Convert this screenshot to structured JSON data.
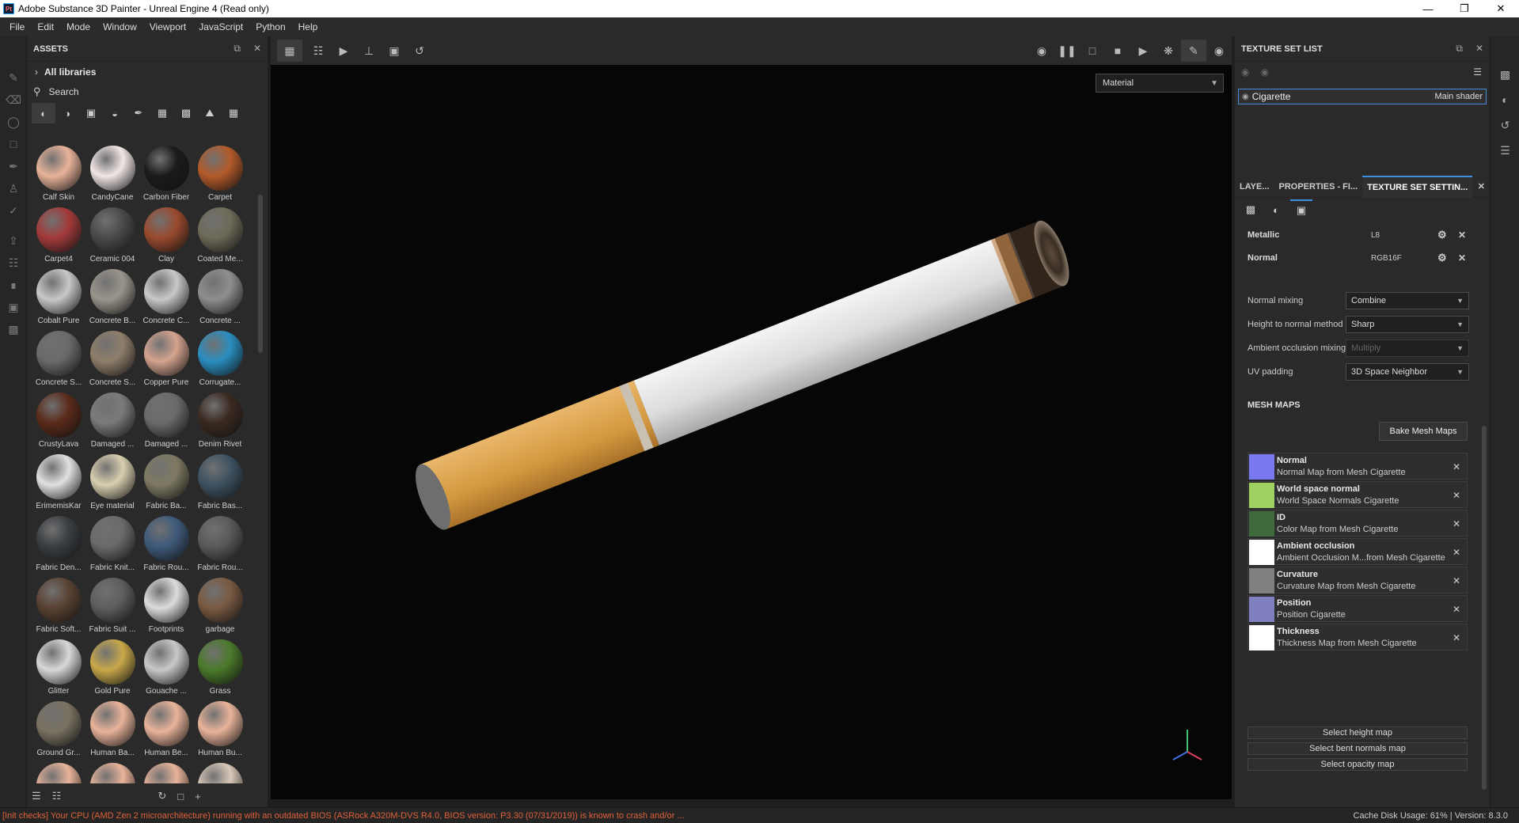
{
  "window": {
    "title": "Adobe Substance 3D Painter - Unreal Engine 4 (Read only)",
    "app_icon_text": "Pt"
  },
  "menu": [
    "File",
    "Edit",
    "Mode",
    "Window",
    "Viewport",
    "JavaScript",
    "Python",
    "Help"
  ],
  "assets": {
    "title": "ASSETS",
    "all_libraries": "All libraries",
    "search_label": "Search",
    "items": [
      {
        "name": "Calf Skin",
        "color": "#e8b39a"
      },
      {
        "name": "CandyCane",
        "color": "#f2e6e6"
      },
      {
        "name": "Carbon Fiber",
        "color": "#1b1b1b"
      },
      {
        "name": "Carpet",
        "color": "#b35a2a"
      },
      {
        "name": "Carpet4",
        "color": "#a33a3a"
      },
      {
        "name": "Ceramic 004",
        "color": "#4a4a4a"
      },
      {
        "name": "Clay",
        "color": "#9a4a2e"
      },
      {
        "name": "Coated Me...",
        "color": "#6e6a58"
      },
      {
        "name": "Cobalt Pure",
        "color": "#c8c8c8"
      },
      {
        "name": "Concrete B...",
        "color": "#9a958c"
      },
      {
        "name": "Concrete C...",
        "color": "#c8c8c8"
      },
      {
        "name": "Concrete ...",
        "color": "#8e8e8e"
      },
      {
        "name": "Concrete S...",
        "color": "#6a6a6a"
      },
      {
        "name": "Concrete S...",
        "color": "#8e7e6a"
      },
      {
        "name": "Copper Pure",
        "color": "#d4a38e"
      },
      {
        "name": "Corrugate...",
        "color": "#2a8ec0"
      },
      {
        "name": "CrustyLava",
        "color": "#5a2a1a"
      },
      {
        "name": "Damaged ...",
        "color": "#7a7a7a"
      },
      {
        "name": "Damaged ...",
        "color": "#6a6a6a"
      },
      {
        "name": "Denim Rivet",
        "color": "#3a2a20"
      },
      {
        "name": "ErimemisKar",
        "color": "#e0e0e0"
      },
      {
        "name": "Eye material",
        "color": "#d8cfb0"
      },
      {
        "name": "Fabric Ba...",
        "color": "#7e7a62"
      },
      {
        "name": "Fabric Bas...",
        "color": "#3e5262"
      },
      {
        "name": "Fabric Den...",
        "color": "#3a3e42"
      },
      {
        "name": "Fabric Knit...",
        "color": "#6a6a6a"
      },
      {
        "name": "Fabric Rou...",
        "color": "#3e5a7a"
      },
      {
        "name": "Fabric Rou...",
        "color": "#5a5a5a"
      },
      {
        "name": "Fabric Soft...",
        "color": "#5a4232"
      },
      {
        "name": "Fabric Suit ...",
        "color": "#5e5e5e"
      },
      {
        "name": "Footprints",
        "color": "#dcdcdc"
      },
      {
        "name": "garbage",
        "color": "#7a5a42"
      },
      {
        "name": "Glitter",
        "color": "#d8d8d8"
      },
      {
        "name": "Gold Pure",
        "color": "#c8a84a"
      },
      {
        "name": "Gouache ...",
        "color": "#c8c8c8"
      },
      {
        "name": "Grass",
        "color": "#4a7a2a"
      },
      {
        "name": "Ground Gr...",
        "color": "#7a7262"
      },
      {
        "name": "Human Ba...",
        "color": "#e8b39a"
      },
      {
        "name": "Human Be...",
        "color": "#e8b39a"
      },
      {
        "name": "Human Bu...",
        "color": "#e8b39a"
      },
      {
        "name": "",
        "color": "#e8b39a"
      },
      {
        "name": "",
        "color": "#e8b39a"
      },
      {
        "name": "",
        "color": "#e8b39a"
      },
      {
        "name": "",
        "color": "#d8c8b8"
      }
    ]
  },
  "viewport": {
    "display_mode": "Material"
  },
  "texture_set_list": {
    "title": "TEXTURE SET LIST",
    "set_name": "Cigarette",
    "shader": "Main shader"
  },
  "tabs": {
    "layers": "LAYE...",
    "properties": "PROPERTIES - FI...",
    "texture_set_settings": "TEXTURE SET SETTIN..."
  },
  "channels": [
    {
      "name": "Metallic",
      "format": "L8"
    },
    {
      "name": "Normal",
      "format": "RGB16F"
    }
  ],
  "settings": {
    "normal_mixing": {
      "label": "Normal mixing",
      "value": "Combine"
    },
    "height_to_normal": {
      "label": "Height to normal method",
      "value": "Sharp"
    },
    "ao_mixing": {
      "label": "Ambient occlusion mixing",
      "value": "Multiply"
    },
    "uv_padding": {
      "label": "UV padding",
      "value": "3D Space Neighbor"
    }
  },
  "mesh_maps": {
    "title": "MESH MAPS",
    "bake_label": "Bake Mesh Maps",
    "items": [
      {
        "name": "Normal",
        "source": "Normal Map from Mesh Cigarette",
        "thumb": "#7a7af0"
      },
      {
        "name": "World space normal",
        "source": "World Space Normals Cigarette",
        "thumb": "#a0d060"
      },
      {
        "name": "ID",
        "source": "Color Map from Mesh Cigarette",
        "thumb": "#3e6a3e"
      },
      {
        "name": "Ambient occlusion",
        "source": "Ambient Occlusion M...from Mesh Cigarette",
        "thumb": "#ffffff"
      },
      {
        "name": "Curvature",
        "source": "Curvature Map from Mesh Cigarette",
        "thumb": "#808080"
      },
      {
        "name": "Position",
        "source": "Position Cigarette",
        "thumb": "#8080c0"
      },
      {
        "name": "Thickness",
        "source": "Thickness Map from Mesh Cigarette",
        "thumb": "#ffffff"
      }
    ],
    "select_height": "Select height map",
    "select_bent": "Select bent normals map",
    "select_opacity": "Select opacity map"
  },
  "status": {
    "error": "[Init checks] Your CPU (AMD Zen 2 microarchitecture) running with an outdated BIOS (ASRock A320M-DVS R4.0, BIOS version: P3.30 (07/31/2019)) is known to crash and/or ...",
    "cache": "Cache Disk Usage:   61% | Version: 8.3.0"
  }
}
